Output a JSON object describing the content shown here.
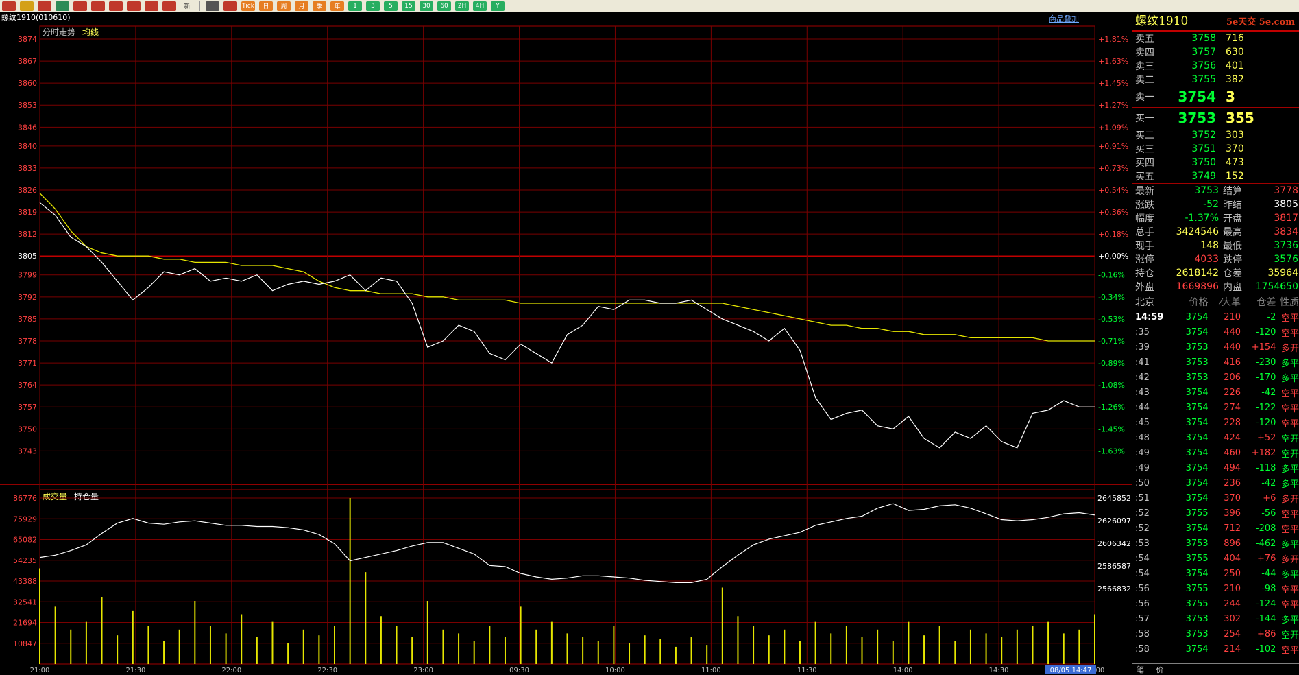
{
  "toolbar": {
    "buttons": [
      {
        "icon": "home-icon",
        "color": "#c0392b",
        "label": ""
      },
      {
        "icon": "folder-icon",
        "color": "#d4a017",
        "label": ""
      },
      {
        "icon": "list-icon",
        "color": "#c0392b",
        "label": ""
      },
      {
        "icon": "refresh-icon",
        "color": "#2e8b57",
        "label": ""
      },
      {
        "icon": "zoom-in-icon",
        "color": "#c0392b",
        "label": ""
      },
      {
        "icon": "zoom-out-icon",
        "color": "#c0392b",
        "label": ""
      },
      {
        "icon": "copy-icon",
        "color": "#c0392b",
        "label": ""
      },
      {
        "icon": "pen-icon",
        "color": "#c0392b",
        "label": ""
      },
      {
        "icon": "eraser-icon",
        "color": "#c0392b",
        "label": ""
      },
      {
        "icon": "pin-icon",
        "color": "#c0392b",
        "label": ""
      },
      {
        "icon": "new-icon",
        "color": "#ece9d8",
        "label": "新"
      }
    ],
    "period_buttons": [
      {
        "icon": "table-icon",
        "color": "#555555",
        "label": ""
      },
      {
        "icon": "timeshare-icon",
        "color": "#c0392b",
        "label": ""
      },
      {
        "icon": "tick-icon",
        "color": "#e67e22",
        "label": "Tick"
      },
      {
        "icon": "day-icon",
        "color": "#e67e22",
        "label": "日"
      },
      {
        "icon": "week-icon",
        "color": "#e67e22",
        "label": "周"
      },
      {
        "icon": "month-icon",
        "color": "#e67e22",
        "label": "月"
      },
      {
        "icon": "season-icon",
        "color": "#e67e22",
        "label": "季"
      },
      {
        "icon": "year-icon",
        "color": "#e67e22",
        "label": "年"
      },
      {
        "icon": "min1-icon",
        "color": "#27ae60",
        "label": "1"
      },
      {
        "icon": "min3-icon",
        "color": "#27ae60",
        "label": "3"
      },
      {
        "icon": "min5-icon",
        "color": "#27ae60",
        "label": "5"
      },
      {
        "icon": "min15-icon",
        "color": "#27ae60",
        "label": "15"
      },
      {
        "icon": "min30-icon",
        "color": "#27ae60",
        "label": "30"
      },
      {
        "icon": "min60-icon",
        "color": "#27ae60",
        "label": "60"
      },
      {
        "icon": "h2-icon",
        "color": "#27ae60",
        "label": "2H"
      },
      {
        "icon": "h4-icon",
        "color": "#27ae60",
        "label": "4H"
      },
      {
        "icon": "y-icon",
        "color": "#27ae60",
        "label": "Y"
      }
    ]
  },
  "header": {
    "symbol": "螺纹1910",
    "code": "(010610)",
    "overlay_link": "商品叠加",
    "main_label": "分时走势",
    "avg_label": "均线",
    "vol_label": "成交量",
    "oi_label": "持仓量"
  },
  "chart_data": {
    "type": "line",
    "price_ticks": [
      3874,
      3867,
      3860,
      3853,
      3846,
      3840,
      3833,
      3826,
      3819,
      3812,
      3805,
      3799,
      3792,
      3785,
      3778,
      3771,
      3764,
      3757,
      3750,
      3743
    ],
    "pct_ticks": [
      "+1.81%",
      "+1.63%",
      "+1.45%",
      "+1.27%",
      "+1.09%",
      "+0.91%",
      "+0.73%",
      "+0.54%",
      "+0.36%",
      "+0.18%",
      "+0.00%",
      "-0.16%",
      "-0.34%",
      "-0.53%",
      "-0.71%",
      "-0.89%",
      "-1.08%",
      "-1.26%",
      "-1.45%",
      "-1.63%"
    ],
    "prev_settle": 3805,
    "vol_ticks": [
      86776,
      75929,
      65082,
      54235,
      43388,
      32541,
      21694,
      10847
    ],
    "oi_ticks": [
      2645852,
      2626097,
      2606342,
      2586587,
      2566832
    ],
    "x_labels": [
      "21:00",
      "21:30",
      "22:00",
      "22:30",
      "23:00",
      "09:30",
      "10:00",
      "11:00",
      "11:30",
      "14:00",
      "14:30",
      "15:00"
    ],
    "x_cursor": "08/05 14:47",
    "price": [
      3822,
      3818,
      3811,
      3808,
      3803,
      3797,
      3791,
      3795,
      3800,
      3799,
      3801,
      3797,
      3798,
      3797,
      3799,
      3794,
      3796,
      3797,
      3796,
      3797,
      3799,
      3794,
      3798,
      3797,
      3790,
      3776,
      3778,
      3783,
      3781,
      3774,
      3772,
      3777,
      3774,
      3771,
      3780,
      3783,
      3789,
      3788,
      3791,
      3791,
      3790,
      3790,
      3791,
      3788,
      3785,
      3783,
      3781,
      3778,
      3782,
      3775,
      3760,
      3753,
      3755,
      3756,
      3751,
      3750,
      3754,
      3747,
      3744,
      3749,
      3747,
      3751,
      3746,
      3744,
      3755,
      3756,
      3759,
      3757,
      3757
    ],
    "avg": [
      3825,
      3820,
      3813,
      3808,
      3806,
      3805,
      3805,
      3805,
      3804,
      3804,
      3803,
      3803,
      3803,
      3802,
      3802,
      3802,
      3801,
      3800,
      3797,
      3795,
      3794,
      3794,
      3793,
      3793,
      3793,
      3792,
      3792,
      3791,
      3791,
      3791,
      3791,
      3790,
      3790,
      3790,
      3790,
      3790,
      3790,
      3790,
      3790,
      3790,
      3790,
      3790,
      3790,
      3790,
      3790,
      3789,
      3788,
      3787,
      3786,
      3785,
      3784,
      3783,
      3783,
      3782,
      3782,
      3781,
      3781,
      3780,
      3780,
      3780,
      3779,
      3779,
      3779,
      3779,
      3779,
      3778,
      3778,
      3778,
      3778
    ],
    "oi": [
      2594000,
      2596000,
      2600000,
      2605000,
      2615000,
      2624000,
      2628000,
      2624000,
      2623000,
      2625000,
      2626000,
      2624000,
      2622000,
      2622000,
      2621000,
      2621000,
      2620000,
      2618000,
      2614000,
      2606000,
      2591000,
      2594000,
      2597000,
      2600000,
      2604000,
      2607000,
      2607000,
      2602000,
      2597000,
      2587000,
      2586000,
      2580000,
      2577000,
      2575000,
      2576000,
      2578000,
      2578000,
      2577000,
      2576000,
      2574000,
      2573000,
      2572000,
      2572000,
      2575000,
      2586000,
      2596000,
      2605000,
      2610000,
      2613000,
      2616000,
      2622000,
      2625000,
      2628000,
      2630000,
      2637000,
      2641000,
      2635000,
      2636000,
      2639000,
      2640000,
      2637000,
      2632000,
      2627000,
      2626000,
      2627000,
      2629000,
      2632000,
      2633000,
      2631000
    ],
    "vol": [
      50000,
      30000,
      18000,
      22000,
      35000,
      15000,
      28000,
      20000,
      12000,
      18000,
      33000,
      20000,
      16000,
      26000,
      14000,
      22000,
      11000,
      18000,
      15000,
      20000,
      86776,
      48000,
      25000,
      20000,
      14000,
      33000,
      18000,
      16000,
      12000,
      20000,
      14000,
      30000,
      18000,
      22000,
      16000,
      14000,
      12000,
      20000,
      11000,
      15000,
      13000,
      9000,
      14000,
      10000,
      40000,
      25000,
      20000,
      15000,
      18000,
      12000,
      22000,
      16000,
      20000,
      14000,
      18000,
      12000,
      22000,
      15000,
      20000,
      12000,
      18000,
      16000,
      14000,
      18000,
      20000,
      22000,
      16000,
      18000,
      26000
    ],
    "xlim": [
      0,
      68
    ]
  },
  "quote": {
    "sell": [
      {
        "label": "卖五",
        "price": "3758",
        "vol": "716"
      },
      {
        "label": "卖四",
        "price": "3757",
        "vol": "630"
      },
      {
        "label": "卖三",
        "price": "3756",
        "vol": "401"
      },
      {
        "label": "卖二",
        "price": "3755",
        "vol": "382"
      }
    ],
    "sell1": {
      "label": "卖一",
      "price": "3754",
      "vol": "3"
    },
    "buy1": {
      "label": "买一",
      "price": "3753",
      "vol": "355"
    },
    "buy": [
      {
        "label": "买二",
        "price": "3752",
        "vol": "303"
      },
      {
        "label": "买三",
        "price": "3751",
        "vol": "370"
      },
      {
        "label": "买四",
        "price": "3750",
        "vol": "473"
      },
      {
        "label": "买五",
        "price": "3749",
        "vol": "152"
      }
    ],
    "stats": [
      {
        "l1": "最新",
        "v1": "3753",
        "c1": "#00ff33",
        "l2": "结算",
        "v2": "3778",
        "c2": "#ff4040"
      },
      {
        "l1": "涨跌",
        "v1": "-52",
        "c1": "#00ff33",
        "l2": "昨结",
        "v2": "3805",
        "c2": "#ffffff"
      },
      {
        "l1": "幅度",
        "v1": "-1.37%",
        "c1": "#00ff33",
        "l2": "开盘",
        "v2": "3817",
        "c2": "#ff4040"
      },
      {
        "l1": "总手",
        "v1": "3424546",
        "c1": "#ffff55",
        "l2": "最高",
        "v2": "3834",
        "c2": "#ff4040"
      },
      {
        "l1": "现手",
        "v1": "148",
        "c1": "#ffff55",
        "l2": "最低",
        "v2": "3736",
        "c2": "#00ff33"
      },
      {
        "l1": "涨停",
        "v1": "4033",
        "c1": "#ff4040",
        "l2": "跌停",
        "v2": "3576",
        "c2": "#00ff33"
      },
      {
        "l1": "持仓",
        "v1": "2618142",
        "c1": "#ffff55",
        "l2": "仓差",
        "v2": "35964",
        "c2": "#ffff55"
      },
      {
        "l1": "外盘",
        "v1": "1669896",
        "c1": "#ff4040",
        "l2": "内盘",
        "v2": "1754650",
        "c2": "#00ff33"
      }
    ],
    "tick_header": {
      "time": "北京",
      "price": "价格",
      "vol": "⁄大单",
      "oi": "仓差",
      "nature": "性质"
    },
    "ticks": [
      {
        "time": "14:59",
        "price": "3754",
        "vol": "210",
        "oi": "-2",
        "nature": "空平",
        "pc": "#00ff33",
        "oc": "#00ff33",
        "nc": "#ff4040"
      },
      {
        "time": ":35",
        "price": "3754",
        "vol": "440",
        "oi": "-120",
        "nature": "空平",
        "pc": "#00ff33",
        "oc": "#00ff33",
        "nc": "#ff4040"
      },
      {
        "time": ":39",
        "price": "3753",
        "vol": "440",
        "oi": "+154",
        "nature": "多开",
        "pc": "#00ff33",
        "oc": "#ff4040",
        "nc": "#ff4040"
      },
      {
        "time": ":41",
        "price": "3753",
        "vol": "416",
        "oi": "-230",
        "nature": "多平",
        "pc": "#00ff33",
        "oc": "#00ff33",
        "nc": "#00ff33"
      },
      {
        "time": ":42",
        "price": "3753",
        "vol": "206",
        "oi": "-170",
        "nature": "多平",
        "pc": "#00ff33",
        "oc": "#00ff33",
        "nc": "#00ff33"
      },
      {
        "time": ":43",
        "price": "3754",
        "vol": "226",
        "oi": "-42",
        "nature": "空平",
        "pc": "#00ff33",
        "oc": "#00ff33",
        "nc": "#ff4040"
      },
      {
        "time": ":44",
        "price": "3754",
        "vol": "274",
        "oi": "-122",
        "nature": "空平",
        "pc": "#00ff33",
        "oc": "#00ff33",
        "nc": "#ff4040"
      },
      {
        "time": ":45",
        "price": "3754",
        "vol": "228",
        "oi": "-120",
        "nature": "空平",
        "pc": "#00ff33",
        "oc": "#00ff33",
        "nc": "#ff4040"
      },
      {
        "time": ":48",
        "price": "3754",
        "vol": "424",
        "oi": "+52",
        "nature": "空开",
        "pc": "#00ff33",
        "oc": "#ff4040",
        "nc": "#00ff33"
      },
      {
        "time": ":49",
        "price": "3754",
        "vol": "460",
        "oi": "+182",
        "nature": "空开",
        "pc": "#00ff33",
        "oc": "#ff4040",
        "nc": "#00ff33"
      },
      {
        "time": ":49",
        "price": "3754",
        "vol": "494",
        "oi": "-118",
        "nature": "多平",
        "pc": "#00ff33",
        "oc": "#00ff33",
        "nc": "#00ff33"
      },
      {
        "time": ":50",
        "price": "3754",
        "vol": "236",
        "oi": "-42",
        "nature": "多平",
        "pc": "#00ff33",
        "oc": "#00ff33",
        "nc": "#00ff33"
      },
      {
        "time": ":51",
        "price": "3754",
        "vol": "370",
        "oi": "+6",
        "nature": "多开",
        "pc": "#00ff33",
        "oc": "#ff4040",
        "nc": "#ff4040"
      },
      {
        "time": ":52",
        "price": "3755",
        "vol": "396",
        "oi": "-56",
        "nature": "空平",
        "pc": "#00ff33",
        "oc": "#00ff33",
        "nc": "#ff4040"
      },
      {
        "time": ":52",
        "price": "3754",
        "vol": "712",
        "oi": "-208",
        "nature": "空平",
        "pc": "#00ff33",
        "oc": "#00ff33",
        "nc": "#ff4040"
      },
      {
        "time": ":53",
        "price": "3753",
        "vol": "896",
        "oi": "-462",
        "nature": "多平",
        "pc": "#00ff33",
        "oc": "#00ff33",
        "nc": "#00ff33"
      },
      {
        "time": ":54",
        "price": "3755",
        "vol": "404",
        "oi": "+76",
        "nature": "多开",
        "pc": "#00ff33",
        "oc": "#ff4040",
        "nc": "#ff4040"
      },
      {
        "time": ":54",
        "price": "3754",
        "vol": "250",
        "oi": "-44",
        "nature": "多平",
        "pc": "#00ff33",
        "oc": "#00ff33",
        "nc": "#00ff33"
      },
      {
        "time": ":56",
        "price": "3755",
        "vol": "210",
        "oi": "-98",
        "nature": "空平",
        "pc": "#00ff33",
        "oc": "#00ff33",
        "nc": "#ff4040"
      },
      {
        "time": ":56",
        "price": "3755",
        "vol": "244",
        "oi": "-124",
        "nature": "空平",
        "pc": "#00ff33",
        "oc": "#00ff33",
        "nc": "#ff4040"
      },
      {
        "time": ":57",
        "price": "3753",
        "vol": "302",
        "oi": "-144",
        "nature": "多平",
        "pc": "#00ff33",
        "oc": "#00ff33",
        "nc": "#00ff33"
      },
      {
        "time": ":58",
        "price": "3753",
        "vol": "254",
        "oi": "+86",
        "nature": "空开",
        "pc": "#00ff33",
        "oc": "#ff4040",
        "nc": "#00ff33"
      },
      {
        "time": ":58",
        "price": "3754",
        "vol": "214",
        "oi": "-102",
        "nature": "空平",
        "pc": "#00ff33",
        "oc": "#00ff33",
        "nc": "#ff4040"
      }
    ],
    "logo": "5e天交 5e.com",
    "tabs": [
      "笔",
      "价"
    ]
  }
}
